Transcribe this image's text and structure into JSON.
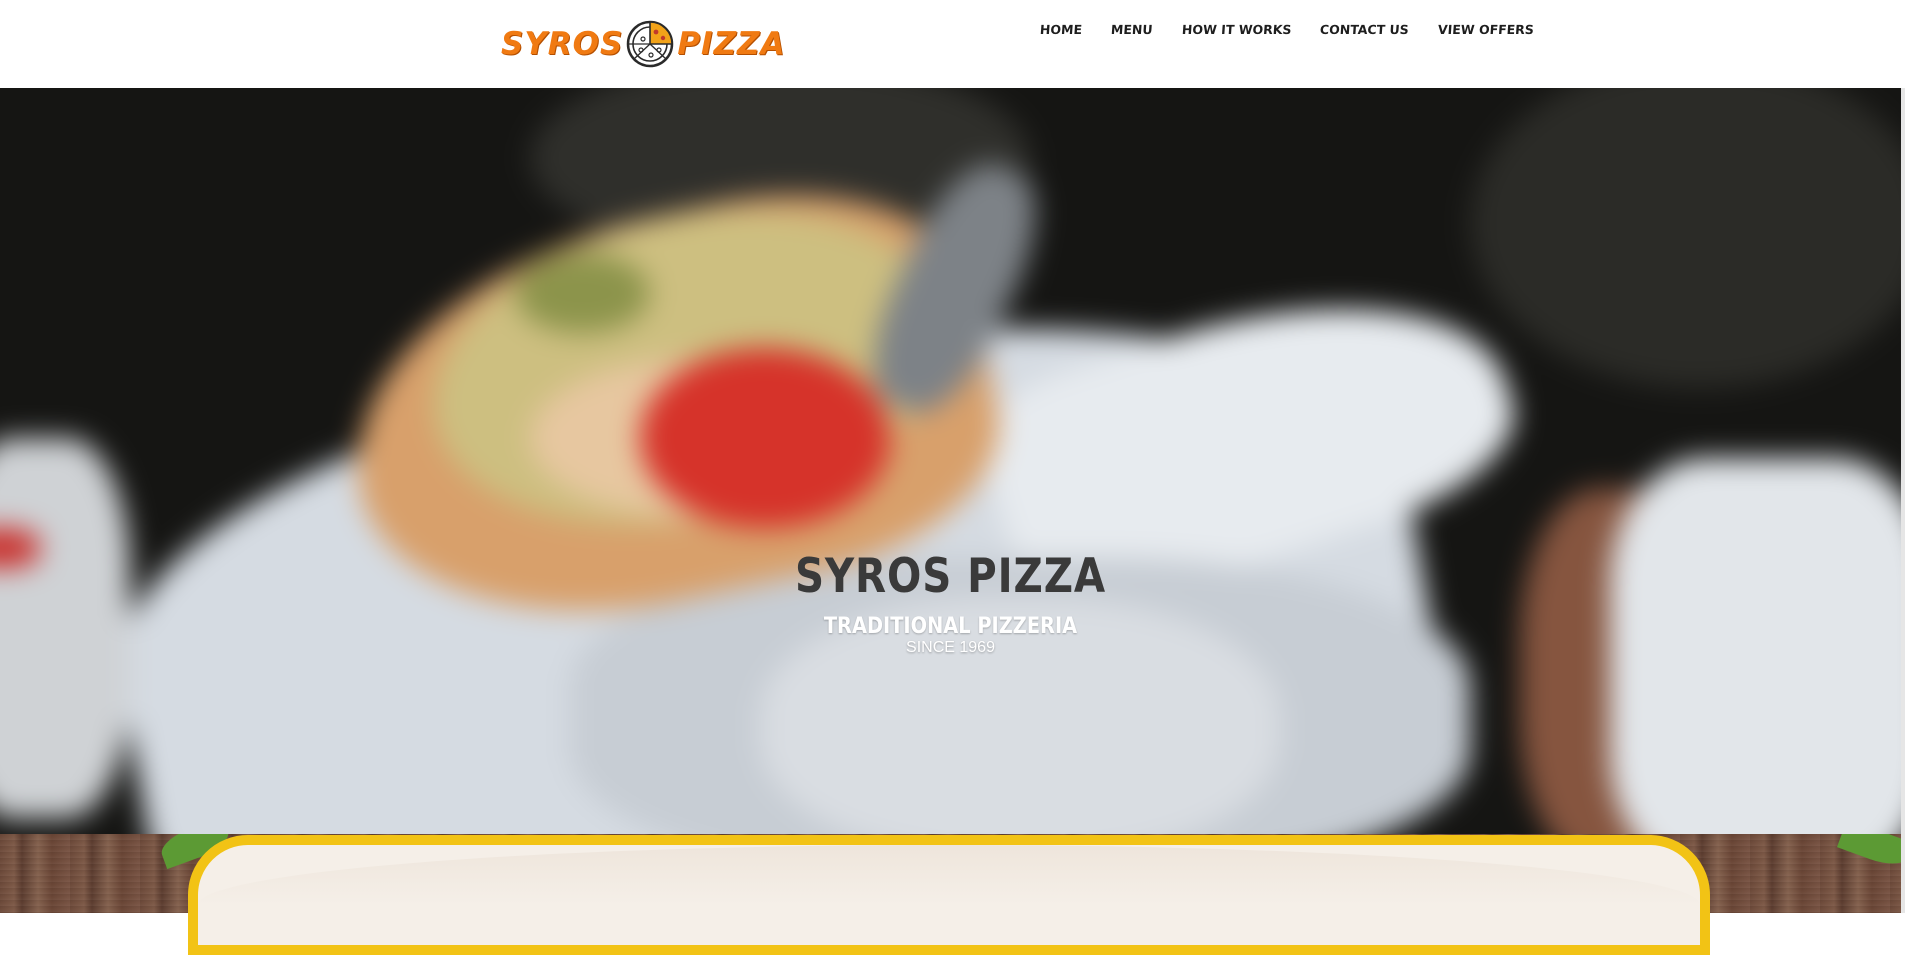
{
  "brand": {
    "logo_left": "SYROS",
    "logo_right": "PIZZA"
  },
  "nav": {
    "items": [
      {
        "label": "HOME"
      },
      {
        "label": "MENU"
      },
      {
        "label": "HOW IT WORKS"
      },
      {
        "label": "CONTACT US"
      },
      {
        "label": "VIEW OFFERS"
      }
    ]
  },
  "hero": {
    "title": "SYROS PIZZA",
    "subtitle": "TRADITIONAL PIZZERIA",
    "tagline": "SINCE 1969"
  },
  "colors": {
    "brand_orange": "#f07a12",
    "frame_yellow": "#f2c315",
    "nav_text": "#1e1e1e",
    "hero_title": "#3a3a3a"
  },
  "icons": {
    "logo_emblem": "pizza-emblem-icon"
  }
}
